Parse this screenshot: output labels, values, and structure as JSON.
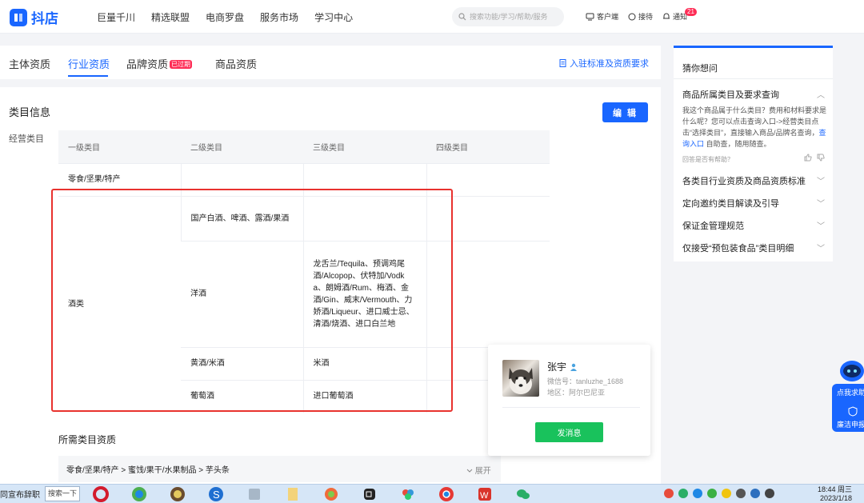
{
  "topnav": {
    "logo_text": "抖店",
    "items": [
      "巨量千川",
      "精选联盟",
      "电商罗盘",
      "服务市场",
      "学习中心"
    ],
    "search_placeholder": "搜索功能/学习/帮助/服务",
    "client_label": "客户端",
    "reception_label": "接待",
    "notify_label": "通知",
    "notify_count": "21"
  },
  "tabs": {
    "items": [
      "主体资质",
      "行业资质",
      "品牌资质",
      "商品资质"
    ],
    "active": "行业资质",
    "expired_badge": "已过期",
    "entry_link": "入驻标准及资质要求"
  },
  "category_info": {
    "title": "类目信息",
    "edit_button": "编 辑",
    "side_label": "经营类目",
    "headers": [
      "一级类目",
      "二级类目",
      "三级类目",
      "四级类目"
    ],
    "rows": [
      {
        "l1": "零食/坚果/特产",
        "l2": "",
        "l3": "",
        "l4": ""
      },
      {
        "l1": "酒类",
        "l2": "国产白酒、啤酒、露酒/果酒",
        "l3": "",
        "l4": ""
      },
      {
        "l2": "洋酒",
        "l3": "龙舌兰/Tequila、预调鸡尾酒/Alcopop、伏特加/Vodka、朗姆酒/Rum、梅酒、金酒/Gin、威末/Vermouth、力娇酒/Liqueur、进口威士忌、清酒/烧酒、进口白兰地",
        "l4": ""
      },
      {
        "l2": "黄酒/米酒",
        "l3": "米酒",
        "l4": ""
      },
      {
        "l2": "葡萄酒",
        "l3": "进口葡萄酒",
        "l4": ""
      }
    ]
  },
  "required": {
    "title": "所需类目资质",
    "path": "零食/坚果/特产 > 蜜饯/果干/水果制品 > 芋头条",
    "expand_label": "展开"
  },
  "help": {
    "title": "猜你想问",
    "q1": "商品所属类目及要求查询",
    "q1_desc_a": "我这个商品属于什么类目？费用和材料要求是什么呢？您可以点击查询入口->经营类目点击“选择类目”，直接输入商品/品牌名查询，",
    "q1_link": "查询入口",
    "q1_desc_b": " 自助查，随用随查。",
    "helpful_label": "回答是否有帮助？",
    "questions": [
      "各类目行业资质及商品资质标准",
      "定向邀约类目解读及引导",
      "保证金管理规范",
      "仅接受“预包装食品”类目明细"
    ]
  },
  "profile": {
    "name": "张宇",
    "wechat": "微信号：tanluzhe_1688",
    "region": "地区：阿尔巴尼亚",
    "send_button": "发消息"
  },
  "floating": {
    "help_label": "点我求助",
    "report_label": "廉洁申报"
  },
  "taskbar": {
    "left_text": "同宣布辞职",
    "search_label": "搜索一下",
    "time": "18:44 周三",
    "date": "2023/1/18"
  },
  "colors": {
    "primary": "#1966ff",
    "danger": "#fe2c55",
    "highlight_box": "#e8322e",
    "send_green": "#19c25c"
  }
}
